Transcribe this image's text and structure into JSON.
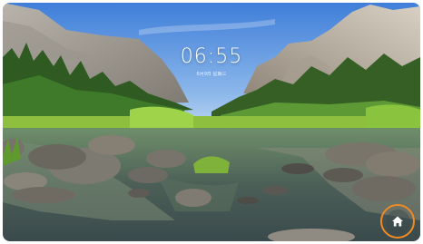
{
  "lock_screen": {
    "time": "06:55",
    "date": "6月9日 星期三"
  },
  "home_button": {
    "icon": "home-icon",
    "ring_color": "#f08a24"
  }
}
